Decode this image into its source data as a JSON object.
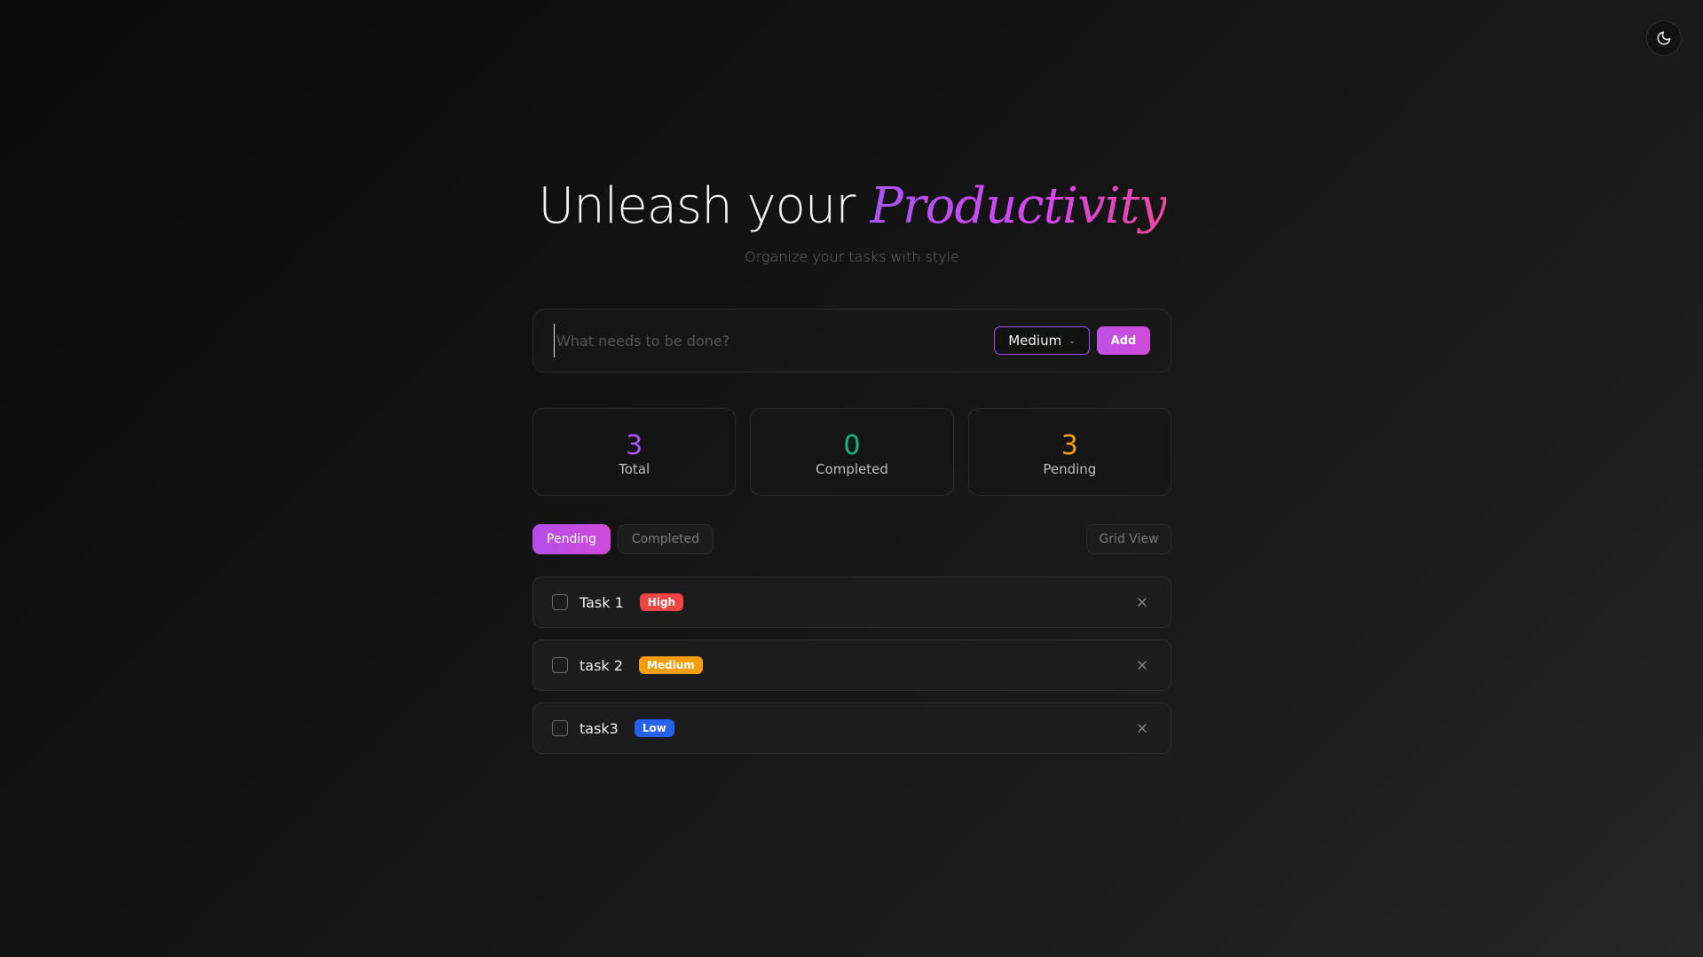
{
  "theme_toggle": {
    "icon": "moon-icon"
  },
  "hero": {
    "title_prefix": "Unleash your ",
    "title_accent": "Productivity",
    "subtitle": "Organize your tasks with style"
  },
  "add_form": {
    "input_value": "",
    "input_placeholder": "What needs to be done?",
    "priority_selected": "Medium",
    "add_label": "Add"
  },
  "stats": [
    {
      "value": "3",
      "label": "Total",
      "color": "#a855f7"
    },
    {
      "value": "0",
      "label": "Completed",
      "color": "#10b981"
    },
    {
      "value": "3",
      "label": "Pending",
      "color": "#f59e0b"
    }
  ],
  "filters": {
    "pending_label": "Pending",
    "completed_label": "Completed",
    "view_label": "Grid View"
  },
  "tasks": [
    {
      "text": "Task 1",
      "priority": "High",
      "badge_color": "#ef4444"
    },
    {
      "text": "task 2",
      "priority": "Medium",
      "badge_color": "#f59e0b"
    },
    {
      "text": "task3",
      "priority": "Low",
      "badge_color": "#2563eb"
    }
  ],
  "colors": {
    "accent_purple": "#a855f7",
    "accent_pink": "#d946ef"
  }
}
